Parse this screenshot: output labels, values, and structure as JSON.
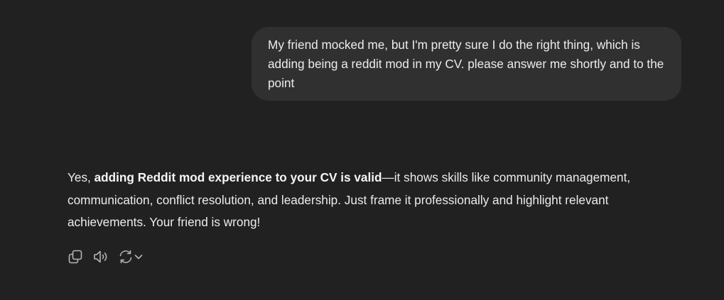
{
  "user_message": {
    "text": "My friend mocked me, but I'm pretty sure I do the right thing, which is adding being a reddit mod in my CV. please answer me shortly and to the point"
  },
  "assistant_message": {
    "lead": "Yes, ",
    "bold": "adding Reddit mod experience to your CV is valid",
    "rest": "—it shows skills like community management, communication, conflict resolution, and leadership. Just frame it professionally and highlight relevant achievements. Your friend is wrong!"
  },
  "actions": {
    "icons": [
      "copy-icon",
      "read-aloud-icon",
      "regenerate-icon",
      "chevron-down-icon"
    ]
  },
  "colors": {
    "background": "#212121",
    "user_bubble": "#303030",
    "text": "#ececec",
    "icon": "#b4b4b4"
  }
}
